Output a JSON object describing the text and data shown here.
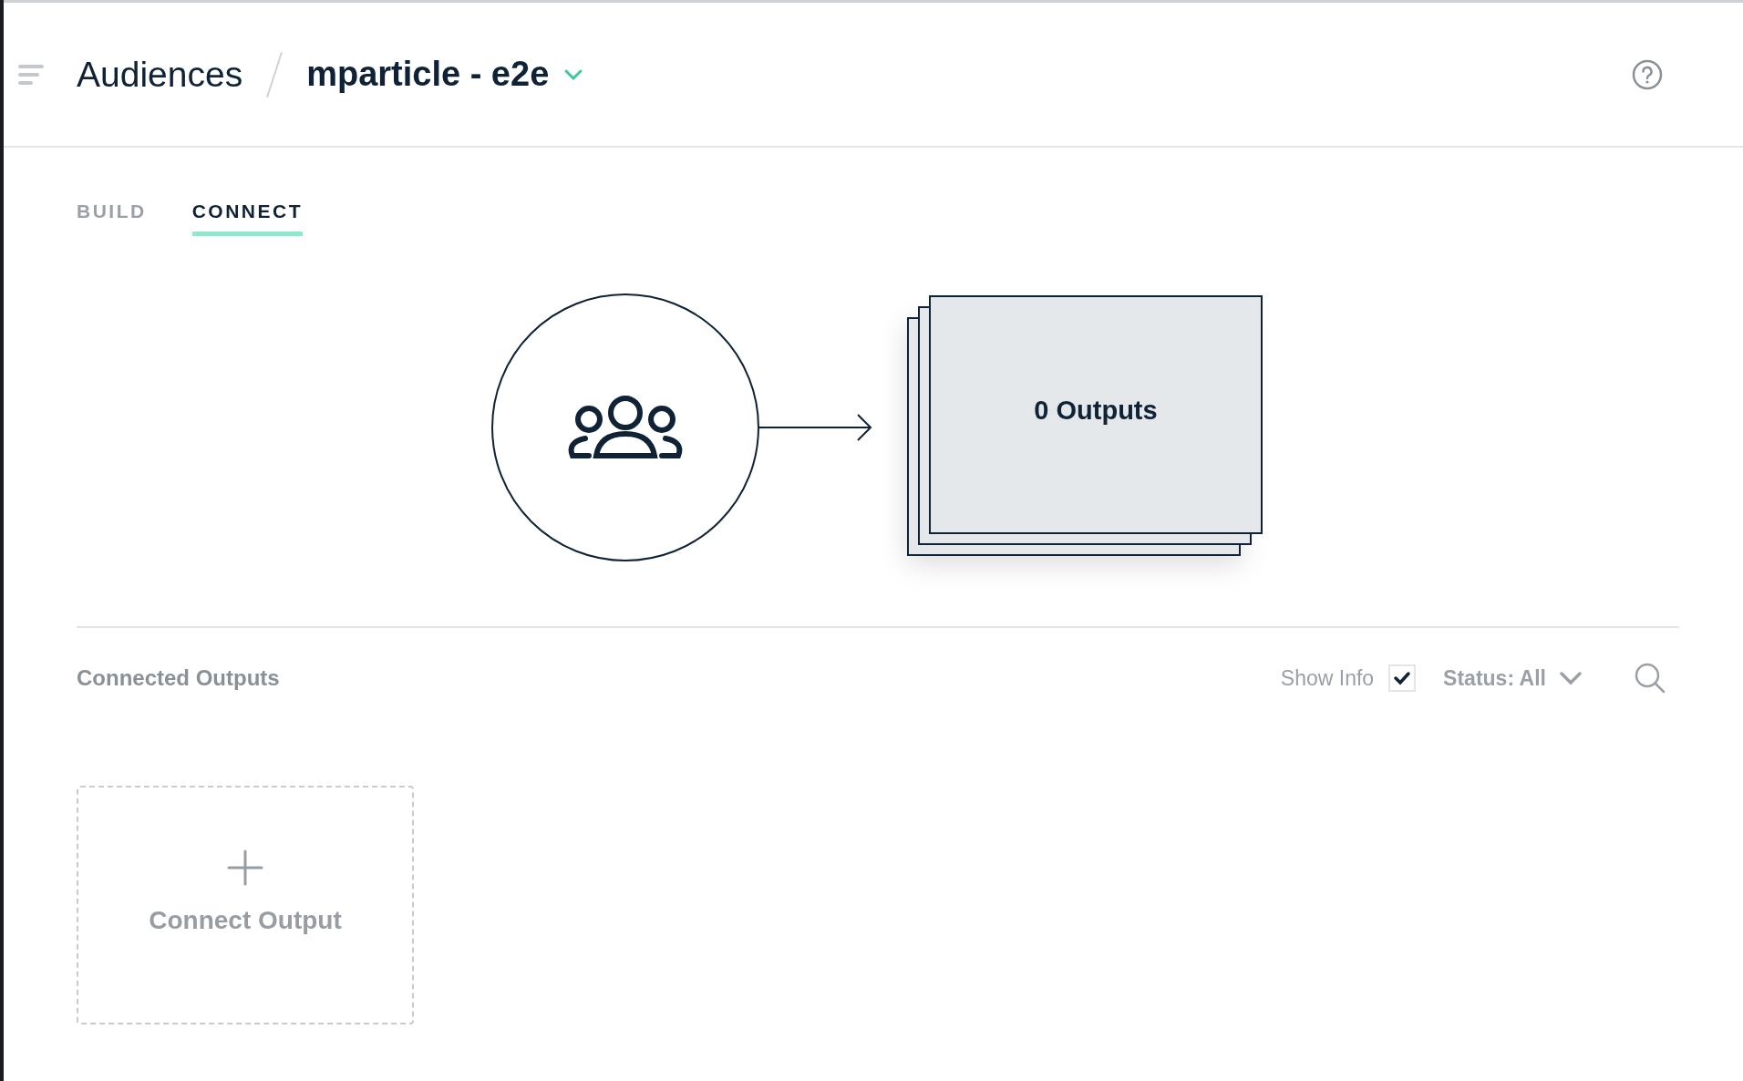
{
  "header": {
    "breadcrumb": [
      "Audiences",
      "mparticle - e2e"
    ]
  },
  "tabs": [
    {
      "label": "BUILD",
      "selected": false
    },
    {
      "label": "CONNECT",
      "selected": true
    }
  ],
  "diagram": {
    "outputs_label": "0 Outputs"
  },
  "connected_outputs": {
    "title": "Connected Outputs",
    "show_info": {
      "label": "Show Info",
      "checked": true
    },
    "status_filter": "Status: All"
  },
  "add_card": {
    "label": "Connect Output"
  }
}
